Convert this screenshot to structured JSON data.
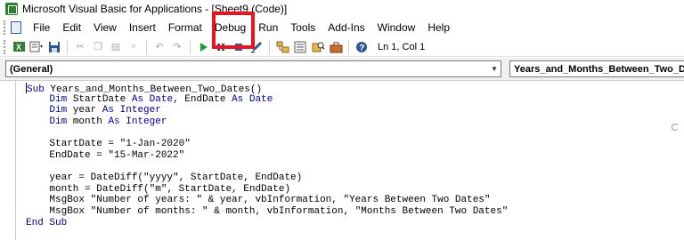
{
  "window": {
    "title": "Microsoft Visual Basic for Applications - [Sheet9 (Code)]"
  },
  "menu": {
    "items": [
      "File",
      "Edit",
      "View",
      "Insert",
      "Format",
      "Debug",
      "Run",
      "Tools",
      "Add-Ins",
      "Window",
      "Help"
    ],
    "highlighted": "Run"
  },
  "toolbar": {
    "position": "Ln 1, Col 1"
  },
  "combos": {
    "object": "(General)",
    "procedure": "Years_and_Months_Between_Two_Dates"
  },
  "code": {
    "lines": [
      "Sub Years_and_Months_Between_Two_Dates()",
      "    Dim StartDate As Date, EndDate As Date",
      "    Dim year As Integer",
      "    Dim month As Integer",
      "",
      "    StartDate = \"1-Jan-2020\"",
      "    EndDate = \"15-Mar-2022\"",
      "",
      "    year = DateDiff(\"yyyy\", StartDate, EndDate)",
      "    month = DateDiff(\"m\", StartDate, EndDate)",
      "    MsgBox \"Number of years: \" & year, vbInformation, \"Years Between Two Dates\"",
      "    MsgBox \"Number of months: \" & month, vbInformation, \"Months Between Two Dates\"",
      "End Sub"
    ]
  },
  "colors": {
    "keyword": "#00008b",
    "highlight_box": "#e8141e"
  },
  "icons": {
    "app": "vba-editor-icon",
    "toolbar": [
      "excel-view-icon",
      "insert-module-icon",
      "save-icon",
      "cut-icon",
      "copy-icon",
      "paste-icon",
      "find-icon",
      "undo-icon",
      "redo-icon",
      "run-icon",
      "break-icon",
      "reset-icon",
      "design-mode-icon",
      "project-explorer-icon",
      "properties-icon",
      "object-browser-icon",
      "toolbox-icon",
      "help-icon"
    ]
  }
}
